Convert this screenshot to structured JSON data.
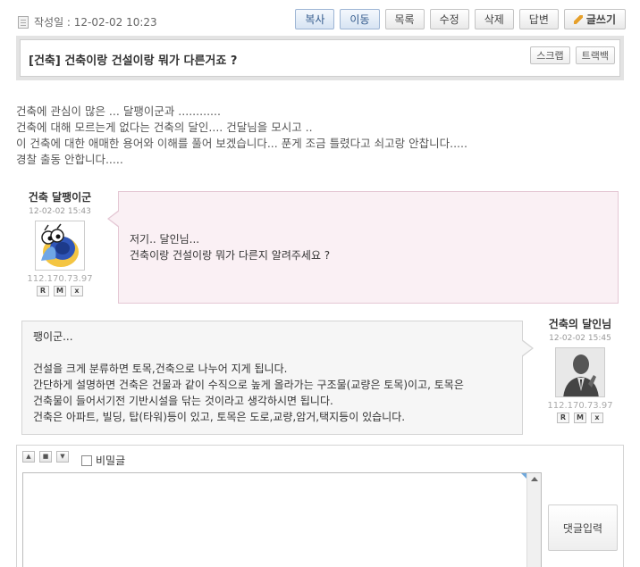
{
  "post": {
    "date_label": "작성일 : 12-02-02 10:23",
    "title": "[건축] 건축이랑 건설이랑 뭐가 다른거죠 ?",
    "body_lines": [
      "건축에 관심이 많은 ... 달팽이군과 ............",
      "건축에 대해 모르는게 없다는 건축의 달인.... 건달님을 모시고 ..",
      "이 건축에 대한 애매한 용어와 이해를 풀어 보겠습니다... 푼게 조금 틀렸다고 쇠고랑 안찹니다.....",
      "경찰 출동 안합니다....."
    ]
  },
  "toolbar": {
    "copy": "복사",
    "move": "이동",
    "list": "목록",
    "edit": "수정",
    "delete": "삭제",
    "reply": "답변",
    "write": "글쓰기"
  },
  "title_actions": {
    "scrap": "스크랩",
    "trackback": "트랙백"
  },
  "comments": [
    {
      "name": "건축 달팽이군",
      "time": "12-02-02 15:43",
      "ip": "112.170.73.97",
      "lines": [
        "저기.. 달인님...",
        "건축이랑 건설이랑 뭐가 다른지 알려주세요 ?"
      ]
    },
    {
      "name": "건축의 달인님",
      "time": "12-02-02 15:45",
      "ip": "112.170.73.97",
      "lines": [
        "팽이군...",
        "",
        "건설을 크게 분류하면 토목,건축으로 나누어 지게 됩니다.",
        "간단하게 설명하면 건축은 건물과 같이 수직으로 높게 올라가는 구조물(교량은 토목)이고, 토목은",
        "건축물이 들어서기전 기반시설을 닦는 것이라고 생각하시면 됩니다.",
        "건축은 아파트, 빌딩, 탑(타워)등이 있고, 토목은 도로,교량,암거,택지등이 있습니다."
      ]
    }
  ],
  "mini_buttons": [
    "R",
    "M",
    "x"
  ],
  "reply_form": {
    "secret_label": "비밀글",
    "submit_label": "댓글입력"
  },
  "icons": {
    "doc": "document-icon",
    "pencil": "pencil-icon",
    "snail_avatar": "snail-avatar",
    "suit_avatar": "businessman-avatar"
  },
  "colors": {
    "pink_bubble": "#faf0f4",
    "gray_bubble": "#f6f6f6",
    "blue_button": "#d7e4f3"
  }
}
